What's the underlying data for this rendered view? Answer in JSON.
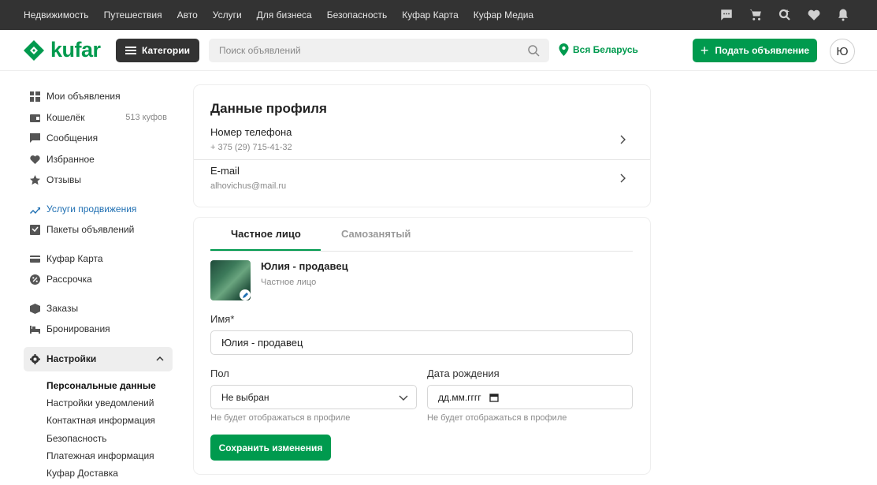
{
  "topnav": [
    "Недвижимость",
    "Путешествия",
    "Авто",
    "Услуги",
    "Для бизнеса",
    "Безопасность",
    "Куфар Карта",
    "Куфар Медиа"
  ],
  "header": {
    "logo_text": "kufar",
    "categories_label": "Категории",
    "search_placeholder": "Поиск объявлений",
    "region": "Вся Беларусь",
    "post_button": "Подать объявление",
    "avatar_letter": "Ю"
  },
  "sidebar": {
    "items": [
      {
        "label": "Мои объявления",
        "icon": "grid-icon"
      },
      {
        "label": "Кошелёк",
        "icon": "wallet-icon",
        "extra": "513 куфов"
      },
      {
        "label": "Сообщения",
        "icon": "chat-icon"
      },
      {
        "label": "Избранное",
        "icon": "heart-icon"
      },
      {
        "label": "Отзывы",
        "icon": "star-icon"
      },
      {
        "label": "Услуги продвижения",
        "icon": "trend-icon",
        "highlight": "#1f6fb2"
      },
      {
        "label": "Пакеты объявлений",
        "icon": "package-icon"
      },
      {
        "label": "Куфар Карта",
        "icon": "card-icon"
      },
      {
        "label": "Рассрочка",
        "icon": "percent-icon"
      },
      {
        "label": "Заказы",
        "icon": "box-icon"
      },
      {
        "label": "Бронирования",
        "icon": "bed-icon"
      }
    ],
    "settings_label": "Настройки",
    "settings_sub": [
      "Персональные данные",
      "Настройки уведомлений",
      "Контактная информация",
      "Безопасность",
      "Платежная информация",
      "Куфар Доставка"
    ]
  },
  "profile": {
    "title": "Данные профиля",
    "phone_label": "Номер телефона",
    "phone_value": "+ 375 (29) 715-41-32",
    "email_label": "E-mail",
    "email_value": "alhovichus@mail.ru"
  },
  "form": {
    "tabs": [
      "Частное лицо",
      "Самозанятый"
    ],
    "name": "Юлия - продавец",
    "type": "Частное лицо",
    "name_label": "Имя*",
    "name_value": "Юлия - продавец",
    "gender_label": "Пол",
    "gender_value": "Не выбран",
    "birth_label": "Дата рождения",
    "birth_placeholder": "дд.мм.гггг",
    "hint": "Не будет отображаться в профиле",
    "save_button": "Сохранить изменения"
  },
  "colors": {
    "brand_green": "#009a4e",
    "link_blue": "#1f6fb2",
    "topbar": "#333333"
  }
}
